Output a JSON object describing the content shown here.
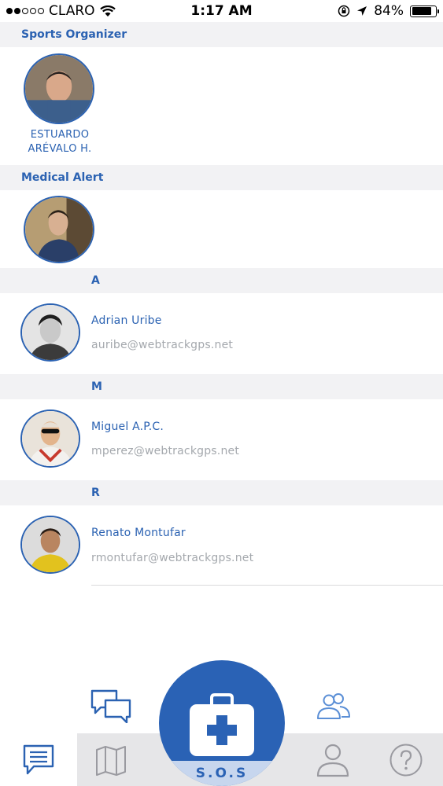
{
  "status_bar": {
    "carrier": "CLARO",
    "time": "1:17 AM",
    "battery": "84%",
    "battery_level": 0.84,
    "signal_bars_filled": 2,
    "signal_bars_total": 5
  },
  "sections": {
    "sports_organizer": {
      "title": "Sports Organizer",
      "contact_name_line1": "ESTUARDO",
      "contact_name_line2": "ARÉVALO H."
    },
    "medical_alert": {
      "title": "Medical Alert"
    }
  },
  "contacts": [
    {
      "letter": "A",
      "name": "Adrian Uribe",
      "email": "auribe@webtrackgps.net"
    },
    {
      "letter": "M",
      "name": "Miguel A.P.C.",
      "email": "mperez@webtrackgps.net"
    },
    {
      "letter": "R",
      "name": "Renato Montufar",
      "email": "rmontufar@webtrackgps.net"
    }
  ],
  "sos": {
    "label": "S.O.S"
  },
  "tabs": [
    {
      "icon": "message-icon",
      "active": true
    },
    {
      "icon": "map-icon",
      "active": false
    },
    {
      "icon": "profile-icon",
      "active": false
    },
    {
      "icon": "help-icon",
      "active": false
    }
  ],
  "colors": {
    "accent": "#2b62b2",
    "section_bg": "#f2f2f4",
    "secondary_text": "#a4a8ad",
    "tab_bar_bg": "#e6e6e8",
    "sos_blue": "#2a62b5"
  }
}
